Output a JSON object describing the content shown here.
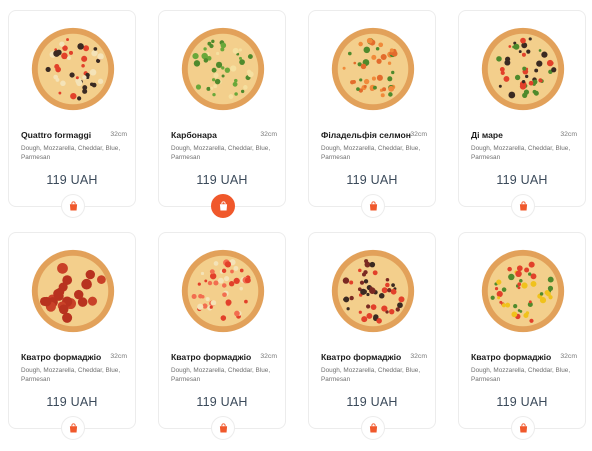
{
  "cards": [
    {
      "name": "Quattro formaggi",
      "size": "32cm",
      "ingredients": "Dough, Mozzarella, Cheddar, Blue, Parmesan",
      "price": "119 UAH",
      "pizza_icon": "pizza-quattro-formaggi",
      "active": false
    },
    {
      "name": "Карбонара",
      "size": "32cm",
      "ingredients": "Dough, Mozzarella, Cheddar, Blue, Parmesan",
      "price": "119 UAH",
      "pizza_icon": "pizza-carbonara",
      "active": true
    },
    {
      "name": "Філадельфія селмон",
      "size": "32cm",
      "ingredients": "Dough, Mozzarella, Cheddar, Blue, Parmesan",
      "price": "119 UAH",
      "pizza_icon": "pizza-philadelphia",
      "active": false
    },
    {
      "name": "Ді маре",
      "size": "32cm",
      "ingredients": "Dough, Mozzarella, Cheddar, Blue, Parmesan",
      "price": "119 UAH",
      "pizza_icon": "pizza-di-mare",
      "active": false
    },
    {
      "name": "Кватро формаджіо",
      "size": "32cm",
      "ingredients": "Dough, Mozzarella, Cheddar, Blue, Parmesan",
      "price": "119 UAH",
      "pizza_icon": "pizza-pepperoni",
      "active": false
    },
    {
      "name": "Кватро формаджіо",
      "size": "32cm",
      "ingredients": "Dough, Mozzarella, Cheddar, Blue, Parmesan",
      "price": "119 UAH",
      "pizza_icon": "pizza-tomato",
      "active": false
    },
    {
      "name": "Кватро формаджіо",
      "size": "32cm",
      "ingredients": "Dough, Mozzarella, Cheddar, Blue, Parmesan",
      "price": "119 UAH",
      "pizza_icon": "pizza-olive",
      "active": false
    },
    {
      "name": "Кватро формаджіо",
      "size": "32cm",
      "ingredients": "Dough, Mozzarella, Cheddar, Blue, Parmesan",
      "price": "119 UAH",
      "pizza_icon": "pizza-pepper",
      "active": false
    }
  ],
  "colors": {
    "accent": "#f0582b",
    "price": "#3b4a5a",
    "card_border": "#ececec",
    "crust": "#e2a15a",
    "cheese": "#f3cf8c",
    "pepperoni": "#b8321f",
    "tomato": "#e2402a",
    "olive": "#3a2a22",
    "greens": "#4f8a2c",
    "pepper_yellow": "#f0c21c"
  },
  "cart_icon": "shopping-bag-icon"
}
